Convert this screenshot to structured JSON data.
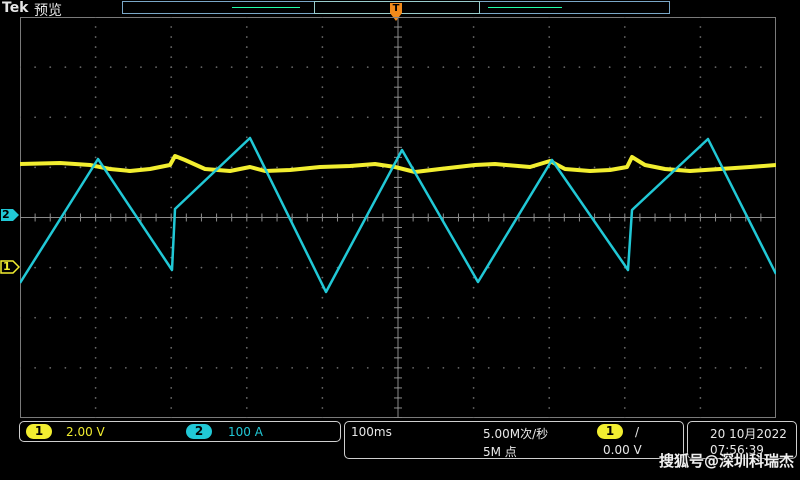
{
  "header": {
    "brand": "Tek",
    "mode": "预览"
  },
  "markers": {
    "trigger_pos": "T",
    "ch2_label": "2",
    "ch1_label": "1"
  },
  "channels": {
    "ch1": {
      "num": "1",
      "scale": "2.00 V",
      "color": "#f2ee30"
    },
    "ch2": {
      "num": "2",
      "scale": "100 A",
      "color": "#21c8d6"
    }
  },
  "timebase": {
    "horizontal": "100ms",
    "sample_rate": "5.00M次/秒",
    "record_length": "5M 点"
  },
  "trigger": {
    "source": "1",
    "slope": "/",
    "level": "0.00 V"
  },
  "datetime": {
    "date": "20 10月2022",
    "time": "07:56:39"
  },
  "watermark": "搜狐号@深圳科瑞杰",
  "colors": {
    "grid": "#6a6a6a",
    "ch1": "#f2ee30",
    "ch2": "#21c8d6",
    "trigger_marker": "#f28a1a"
  }
}
